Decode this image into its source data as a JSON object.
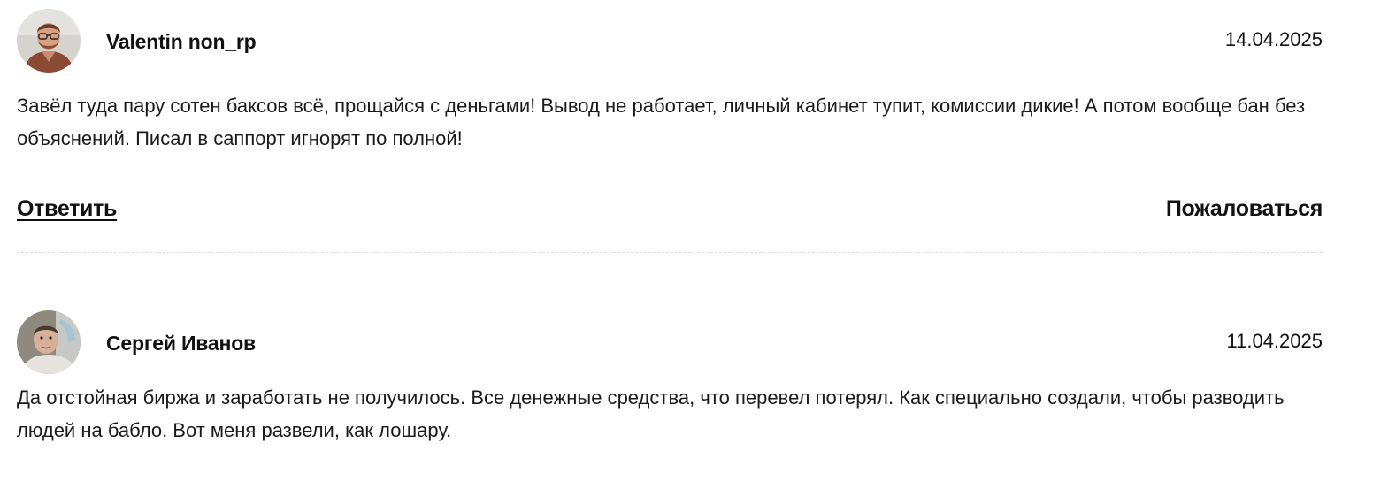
{
  "comments": [
    {
      "author": "Valentin non_rp",
      "date": "14.04.2025",
      "avatar_icon": "user-avatar-photo",
      "text": "Завёл туда пару сотен баксов всё, прощайся с деньгами! Вывод не работает, личный кабинет тупит, комиссии дикие! А потом вообще бан без объяснений. Писал в саппорт игнорят по полной!",
      "reply_label": "Ответить",
      "report_label": "Пожаловаться"
    },
    {
      "author": "Сергей Иванов",
      "date": "11.04.2025",
      "avatar_icon": "user-avatar-photo",
      "text": "Да отстойная биржа и заработать не получилось. Все денежные средства, что перевел потерял. Как специально создали, чтобы разводить людей на бабло. Вот меня развели, как лошару."
    }
  ],
  "colors": {
    "text": "#111111",
    "divider": "#dddddd",
    "background": "#ffffff"
  }
}
